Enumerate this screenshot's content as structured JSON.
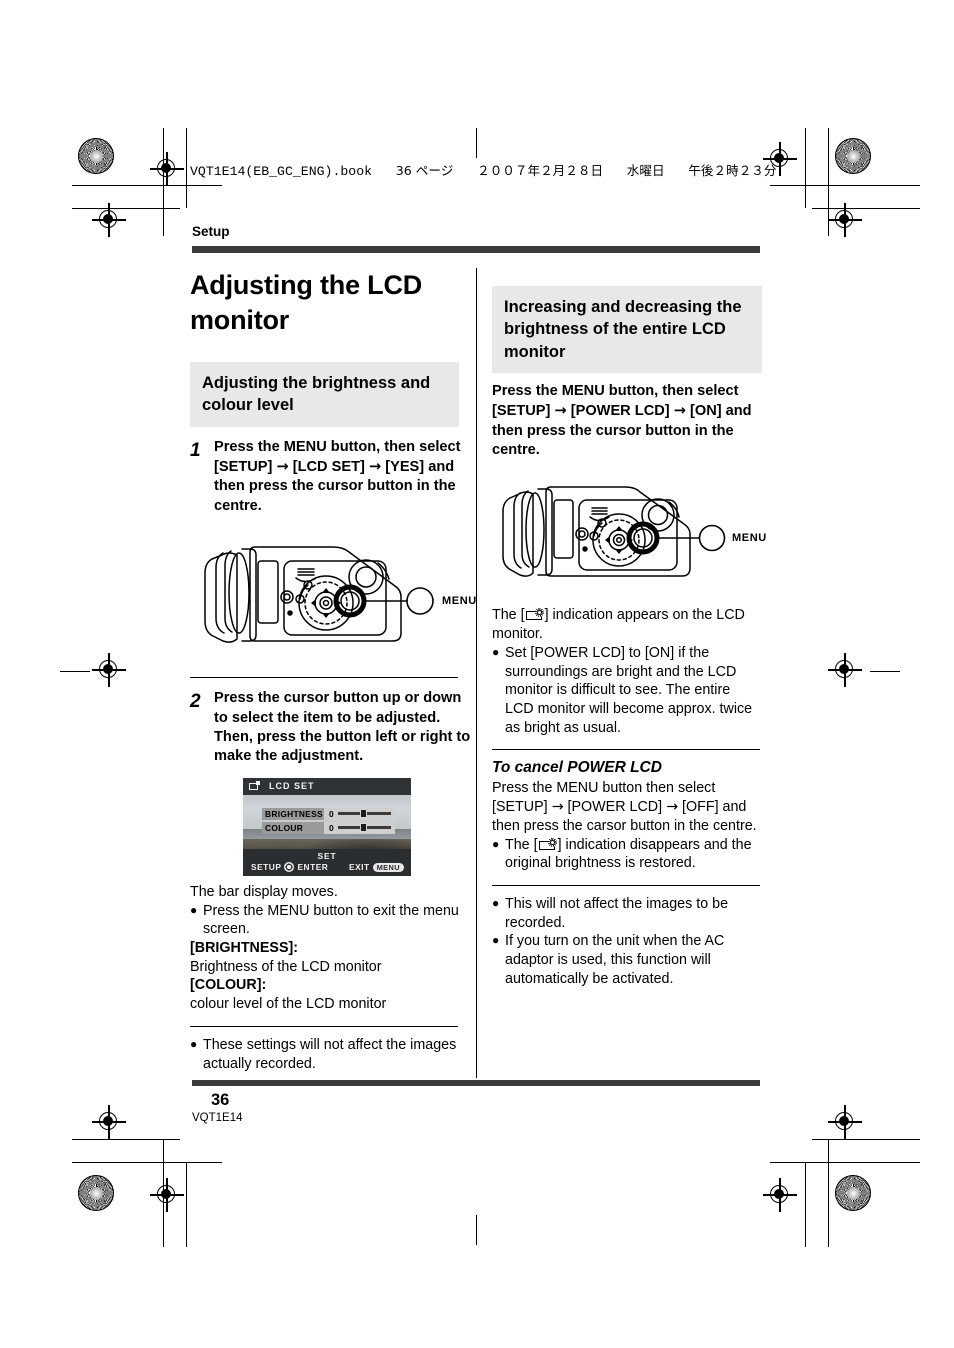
{
  "print_header": {
    "filename": "VQT1E14(EB_GC_ENG).book",
    "page_marker": "36 ページ",
    "date": "２００７年２月２８日",
    "weekday": "水曜日",
    "time": "午後２時２３分",
    "full": "VQT1E14(EB_GC_ENG).book  36 ページ  ２００７年２月２８日  水曜日  午後２時２３分"
  },
  "section_label": "Setup",
  "left_column": {
    "title": "Adjusting the LCD monitor",
    "subhead": "Adjusting the brightness and colour level",
    "step1": {
      "number": "1",
      "text_a": "Press the MENU button, then select [SETUP] ",
      "arrow1": "→",
      "text_b": " [LCD SET] ",
      "arrow2": "→",
      "text_c": " [YES] and then press the cursor button in the centre."
    },
    "figure1": {
      "callout_label": "MENU",
      "alt": "camera rear view with MENU button highlighted"
    },
    "step2": {
      "number": "2",
      "text": "Press the cursor button up or down to select the item to be adjusted. Then, press the button left or right to make the adjustment."
    },
    "lcd_screenshot": {
      "title": "LCD SET",
      "rows": [
        {
          "label": "BRIGHTNESS",
          "value": "0"
        },
        {
          "label": "COLOUR",
          "value": "0"
        }
      ],
      "footer_set": "SET",
      "footer_left": "SETUP",
      "footer_enter": "ENTER",
      "footer_exit": "EXIT",
      "footer_exit_key": "MENU"
    },
    "after_shot": {
      "line1": "The bar display moves.",
      "bullet1": "Press the MENU button to exit the menu screen.",
      "term1": "[BRIGHTNESS]:",
      "def1": "Brightness of the LCD monitor",
      "term2": "[COLOUR]:",
      "def2": "colour level of the LCD monitor"
    },
    "final_bullet": "These settings will not affect the images actually recorded."
  },
  "right_column": {
    "subhead": "Increasing and decreasing the brightness of the entire LCD monitor",
    "intro": {
      "text_a": "Press the MENU button, then select [SETUP] ",
      "arrow1": "→",
      "text_b": " [POWER LCD] ",
      "arrow2": "→",
      "text_c": " [ON] and then press the cursor button in the centre."
    },
    "figure2": {
      "callout_label": "MENU",
      "alt": "camera rear view with MENU button highlighted"
    },
    "indication": {
      "prefix": "The [",
      "suffix": "] indication appears on the LCD monitor."
    },
    "bullet_on": "Set [POWER LCD] to [ON] if the surroundings are bright and the LCD monitor is difficult to see. The entire LCD monitor will become approx. twice as bright as usual.",
    "cancel_heading": "To cancel POWER LCD",
    "cancel_body": {
      "text_a": "Press the MENU button then select [SETUP] ",
      "arrow1": "→",
      "text_b": " [POWER LCD] ",
      "arrow2": "→",
      "text_c": " [OFF] and then press the carsor button in the centre."
    },
    "cancel_bullet": {
      "prefix": "The [",
      "suffix": "] indication disappears and the original brightness is restored."
    },
    "final_bullets": [
      "This will not affect the images to be recorded.",
      "If you turn on the unit when the AC adaptor is used, this function will automatically be activated."
    ]
  },
  "footer": {
    "page_number": "36",
    "doc_code": "VQT1E14"
  },
  "colors": {
    "shaded_head_bg": "#e8e8e8",
    "rule": "#3b3b3b",
    "text": "#000000"
  }
}
